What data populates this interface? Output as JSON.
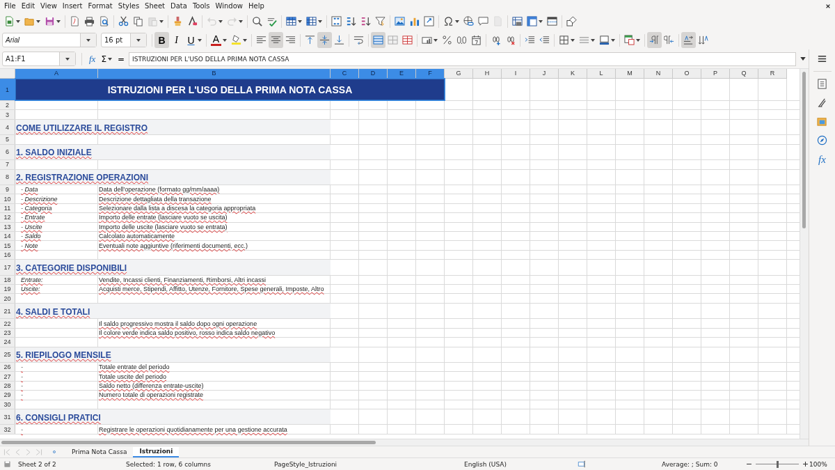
{
  "menu": [
    "File",
    "Edit",
    "View",
    "Insert",
    "Format",
    "Styles",
    "Sheet",
    "Data",
    "Tools",
    "Window",
    "Help"
  ],
  "standard_toolbar": [
    {
      "items": [
        {
          "kind": "new",
          "dropdown": true,
          "disabled": false
        },
        {
          "kind": "open",
          "dropdown": true,
          "disabled": false
        },
        {
          "kind": "save",
          "dropdown": true,
          "disabled": false
        }
      ]
    },
    {
      "items": [
        {
          "kind": "pdf",
          "dropdown": false,
          "disabled": false
        },
        {
          "kind": "print",
          "dropdown": false,
          "disabled": false
        },
        {
          "kind": "preview",
          "dropdown": false,
          "disabled": false
        }
      ]
    },
    {
      "items": [
        {
          "kind": "cut",
          "dropdown": false,
          "disabled": false
        },
        {
          "kind": "copy",
          "dropdown": false,
          "disabled": false
        },
        {
          "kind": "paste",
          "dropdown": true,
          "disabled": true
        }
      ]
    },
    {
      "items": [
        {
          "kind": "clone",
          "dropdown": false,
          "disabled": false
        },
        {
          "kind": "clear",
          "dropdown": false,
          "disabled": false
        }
      ]
    },
    {
      "items": [
        {
          "kind": "undo",
          "dropdown": true,
          "disabled": true
        },
        {
          "kind": "redo",
          "dropdown": true,
          "disabled": true
        }
      ]
    },
    {
      "items": [
        {
          "kind": "find",
          "dropdown": false,
          "disabled": false
        },
        {
          "kind": "spelling",
          "dropdown": false,
          "disabled": false
        }
      ]
    },
    {
      "items": [
        {
          "kind": "rows",
          "dropdown": true,
          "disabled": false
        },
        {
          "kind": "columns",
          "dropdown": true,
          "disabled": false
        }
      ]
    },
    {
      "items": [
        {
          "kind": "sort",
          "dropdown": false,
          "disabled": false
        },
        {
          "kind": "sortasc",
          "dropdown": false,
          "disabled": false
        },
        {
          "kind": "sortdesc",
          "dropdown": false,
          "disabled": false
        },
        {
          "kind": "filter",
          "dropdown": false,
          "disabled": false
        }
      ]
    },
    {
      "items": [
        {
          "kind": "image",
          "dropdown": false,
          "disabled": false
        },
        {
          "kind": "chart",
          "dropdown": false,
          "disabled": false
        },
        {
          "kind": "pivot",
          "dropdown": false,
          "disabled": false
        }
      ]
    },
    {
      "items": [
        {
          "kind": "special",
          "dropdown": true,
          "disabled": false
        },
        {
          "kind": "hyperlink",
          "dropdown": false,
          "disabled": false
        },
        {
          "kind": "comment",
          "dropdown": false,
          "disabled": false
        },
        {
          "kind": "headerfooter",
          "dropdown": false,
          "disabled": true
        }
      ]
    },
    {
      "items": [
        {
          "kind": "printarea",
          "dropdown": false,
          "disabled": false
        },
        {
          "kind": "freeze",
          "dropdown": true,
          "disabled": false
        },
        {
          "kind": "split",
          "dropdown": false,
          "disabled": false
        }
      ]
    },
    {
      "items": [
        {
          "kind": "shapes",
          "dropdown": false,
          "disabled": false
        }
      ]
    }
  ],
  "format_toolbar": {
    "font": "Arial",
    "size": "16 pt",
    "groups": [
      {
        "items": [
          {
            "kind": "bold",
            "label": "B",
            "dropdown": false,
            "selected": true
          },
          {
            "kind": "italic",
            "label": "I",
            "dropdown": false,
            "selected": false
          },
          {
            "kind": "underline",
            "label": "U",
            "dropdown": true,
            "selected": false
          }
        ]
      },
      {
        "items": [
          {
            "kind": "font_color",
            "label": "A",
            "dropdown": true,
            "selected": false
          },
          {
            "kind": "highlight",
            "dropdown": true,
            "selected": false
          }
        ]
      },
      {
        "items": [
          {
            "kind": "left",
            "dropdown": false,
            "selected": false
          },
          {
            "kind": "center",
            "dropdown": false,
            "selected": true
          },
          {
            "kind": "right",
            "dropdown": false,
            "selected": false
          }
        ]
      },
      {
        "items": [
          {
            "kind": "top",
            "dropdown": false,
            "selected": false
          },
          {
            "kind": "middle",
            "dropdown": false,
            "selected": true
          },
          {
            "kind": "bottom",
            "dropdown": false,
            "selected": false
          }
        ]
      },
      {
        "items": [
          {
            "kind": "wrap",
            "dropdown": false,
            "selected": false
          }
        ]
      },
      {
        "items": [
          {
            "kind": "merge_center",
            "dropdown": false,
            "selected": true
          },
          {
            "kind": "merge",
            "dropdown": false,
            "selected": false
          },
          {
            "kind": "unmerge",
            "dropdown": false,
            "selected": false
          }
        ]
      },
      {
        "items": [
          {
            "kind": "currency",
            "dropdown": true,
            "selected": false
          },
          {
            "kind": "percent",
            "dropdown": false,
            "selected": false
          },
          {
            "kind": "number",
            "dropdown": false,
            "selected": false
          },
          {
            "kind": "date",
            "dropdown": false,
            "selected": false
          }
        ]
      },
      {
        "items": [
          {
            "kind": "add_decimal",
            "dropdown": false,
            "selected": false
          },
          {
            "kind": "del_decimal",
            "dropdown": false,
            "selected": false
          }
        ]
      },
      {
        "items": [
          {
            "kind": "indent",
            "dropdown": false,
            "selected": false
          },
          {
            "kind": "outdent",
            "dropdown": false,
            "selected": false
          }
        ]
      },
      {
        "items": [
          {
            "kind": "borders",
            "dropdown": true,
            "selected": false
          },
          {
            "kind": "border_style",
            "dropdown": true,
            "selected": false
          },
          {
            "kind": "border_color",
            "dropdown": true,
            "selected": false
          }
        ]
      },
      {
        "items": [
          {
            "kind": "conditional",
            "dropdown": true,
            "selected": false
          }
        ]
      },
      {
        "items": [
          {
            "kind": "ltr",
            "dropdown": false,
            "selected": true
          },
          {
            "kind": "rtl",
            "dropdown": false,
            "selected": false
          }
        ]
      },
      {
        "items": [
          {
            "kind": "text_dir",
            "dropdown": false,
            "selected": true
          },
          {
            "kind": "stacked",
            "dropdown": false,
            "selected": false
          }
        ]
      }
    ]
  },
  "formula_bar": {
    "name_box": "A1:F1",
    "function_wizard": "fx",
    "sum": "Σ",
    "equals": "=",
    "content": "ISTRUZIONI PER L'USO DELLA PRIMA NOTA CASSA"
  },
  "sidebar": [
    {
      "kind": "menu"
    },
    {
      "kind": "properties"
    },
    {
      "kind": "styles"
    },
    {
      "kind": "gallery"
    },
    {
      "kind": "navigator"
    },
    {
      "kind": "functions",
      "label": "fx"
    }
  ],
  "sheet": {
    "columns": [
      {
        "label": "A",
        "selected": true
      },
      {
        "label": "B",
        "selected": true
      },
      {
        "label": "C",
        "selected": true
      },
      {
        "label": "D",
        "selected": true
      },
      {
        "label": "E",
        "selected": true
      },
      {
        "label": "F",
        "selected": true
      },
      {
        "label": "G",
        "selected": false
      },
      {
        "label": "H",
        "selected": false
      },
      {
        "label": "I",
        "selected": false
      },
      {
        "label": "J",
        "selected": false
      },
      {
        "label": "K",
        "selected": false
      },
      {
        "label": "L",
        "selected": false
      },
      {
        "label": "M",
        "selected": false
      },
      {
        "label": "N",
        "selected": false
      },
      {
        "label": "O",
        "selected": false
      },
      {
        "label": "P",
        "selected": false
      },
      {
        "label": "Q",
        "selected": false
      },
      {
        "label": "R",
        "selected": false
      }
    ],
    "rows": [
      {
        "number": "1",
        "selected": true,
        "kind": "title",
        "a": "ISTRUZIONI PER L'USO DELLA PRIMA NOTA CASSA"
      },
      {
        "number": "2",
        "selected": false,
        "kind": "blank"
      },
      {
        "number": "3",
        "selected": false,
        "kind": "blank"
      },
      {
        "number": "4",
        "selected": false,
        "kind": "heading",
        "a": "COME UTILIZZARE IL REGISTRO"
      },
      {
        "number": "5",
        "selected": false,
        "kind": "blank"
      },
      {
        "number": "6",
        "selected": false,
        "kind": "heading",
        "a": "1. SALDO INIZIALE"
      },
      {
        "number": "7",
        "selected": false,
        "kind": "blank"
      },
      {
        "number": "8",
        "selected": false,
        "kind": "heading",
        "a": "2. REGISTRAZIONE OPERAZIONI"
      },
      {
        "number": "9",
        "selected": false,
        "kind": "item",
        "a": "- Data",
        "b": "Data dell'operazione (formato gg/mm/aaaa)"
      },
      {
        "number": "10",
        "selected": false,
        "kind": "item",
        "a": "- Descrizione",
        "b": "Descrizione dettagliata della transazione"
      },
      {
        "number": "11",
        "selected": false,
        "kind": "item",
        "a": "- Categoria",
        "b": "Selezionare dalla lista a discesa la categoria appropriata"
      },
      {
        "number": "12",
        "selected": false,
        "kind": "item",
        "a": "- Entrate",
        "b": "Importo delle entrate (lasciare vuoto se uscita)"
      },
      {
        "number": "13",
        "selected": false,
        "kind": "item",
        "a": "- Uscite",
        "b": "Importo delle uscite (lasciare vuoto se entrata)"
      },
      {
        "number": "14",
        "selected": false,
        "kind": "item",
        "a": "- Saldo",
        "b": "Calcolato automaticamente"
      },
      {
        "number": "15",
        "selected": false,
        "kind": "item",
        "a": "- Note",
        "b": "Eventuali note aggiuntive (riferimenti documenti, ecc.)"
      },
      {
        "number": "16",
        "selected": false,
        "kind": "blank"
      },
      {
        "number": "17",
        "selected": false,
        "kind": "heading",
        "a": "3. CATEGORIE DISPONIBILI"
      },
      {
        "number": "18",
        "selected": false,
        "kind": "item",
        "a": "Entrate:",
        "b": "Vendite, Incassi clienti, Finanziamenti, Rimborsi, Altri incassi"
      },
      {
        "number": "19",
        "selected": false,
        "kind": "item",
        "a": "Uscite:",
        "b": "Acquisti merce, Stipendi, Affitto, Utenze, Fornitore, Spese generali, Imposte, Altro"
      },
      {
        "number": "20",
        "selected": false,
        "kind": "blank"
      },
      {
        "number": "21",
        "selected": false,
        "kind": "heading",
        "a": "4. SALDI E TOTALI"
      },
      {
        "number": "22",
        "selected": false,
        "kind": "item",
        "b": "Il saldo progressivo mostra il saldo dopo ogni operazione"
      },
      {
        "number": "23",
        "selected": false,
        "kind": "item",
        "b": "Il colore verde indica saldo positivo, rosso indica saldo negativo"
      },
      {
        "number": "24",
        "selected": false,
        "kind": "blank"
      },
      {
        "number": "25",
        "selected": false,
        "kind": "heading",
        "a": "5. RIEPILOGO MENSILE"
      },
      {
        "number": "26",
        "selected": false,
        "kind": "item",
        "a": "-",
        "b": "Totale entrate del periodo"
      },
      {
        "number": "27",
        "selected": false,
        "kind": "item",
        "a": "-",
        "b": "Totale uscite del periodo"
      },
      {
        "number": "28",
        "selected": false,
        "kind": "item",
        "a": "-",
        "b": "Saldo netto (differenza entrate-uscite)"
      },
      {
        "number": "29",
        "selected": false,
        "kind": "item",
        "a": "-",
        "b": "Numero totale di operazioni registrate"
      },
      {
        "number": "30",
        "selected": false,
        "kind": "blank"
      },
      {
        "number": "31",
        "selected": false,
        "kind": "heading",
        "a": "6. CONSIGLI PRATICI"
      },
      {
        "number": "32",
        "selected": false,
        "kind": "item",
        "a": "-",
        "b": "Registrare le operazioni quotidianamente per una gestione accurata"
      }
    ]
  },
  "sheet_tabs": [
    {
      "label": "Prima Nota Cassa",
      "selected": false
    },
    {
      "label": "Istruzioni",
      "selected": true
    }
  ],
  "status_bar": {
    "sheet": "Sheet 2 of 2",
    "selection": "Selected: 1 row, 6 columns",
    "page_style": "PageStyle_Istruzioni",
    "language": "English (USA)",
    "summary": "Average: ; Sum: 0",
    "zoom": {
      "level": 0.5,
      "reading": "100%"
    }
  }
}
